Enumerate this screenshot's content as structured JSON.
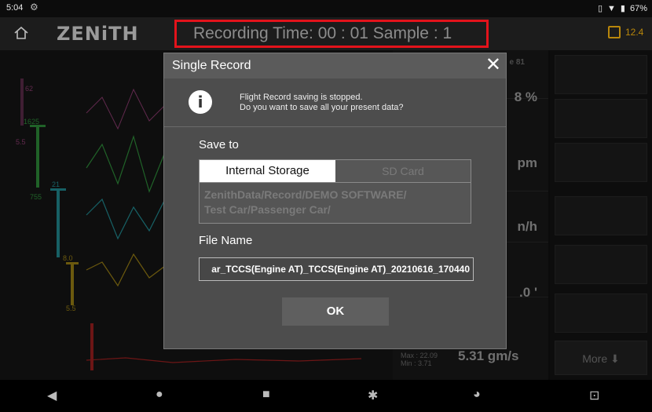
{
  "status": {
    "time": "5:04",
    "battery": "67%"
  },
  "app": {
    "logo": "ZENiTH",
    "recording": "Recording Time: 00 : 01 Sample : 1",
    "battery_value": "12.4"
  },
  "readouts": {
    "r1": "8 %",
    "r2": "pm",
    "r3": "n/h",
    "r4": ".0 '",
    "main_value": "5.31 gm/s",
    "max": "Max : 22.09",
    "min": "Min : 3.71",
    "hint": "e 81"
  },
  "axis_labels": {
    "a1": "62",
    "a2": "1625",
    "a3": "5.5",
    "a4": "755",
    "a5": "21",
    "a6": "8.0",
    "a7": "5.5"
  },
  "more_button": "More ⬇",
  "dialog": {
    "title": "Single Record",
    "message_line1": "Flight Record saving is stopped.",
    "message_line2": "Do you want to save all your present data?",
    "save_to_label": "Save to",
    "tab_internal": "Internal Storage",
    "tab_sd": "SD Card",
    "path_line1": "ZenithData/Record/DEMO SOFTWARE/",
    "path_line2": "Test Car/Passenger Car/",
    "file_name_label": "File Name",
    "file_name": "ar_TCCS(Engine AT)_TCCS(Engine AT)_20210616_170440",
    "ok_label": "OK"
  },
  "colors": {
    "red_box": "#e3131b",
    "accent": "#b8860b"
  }
}
